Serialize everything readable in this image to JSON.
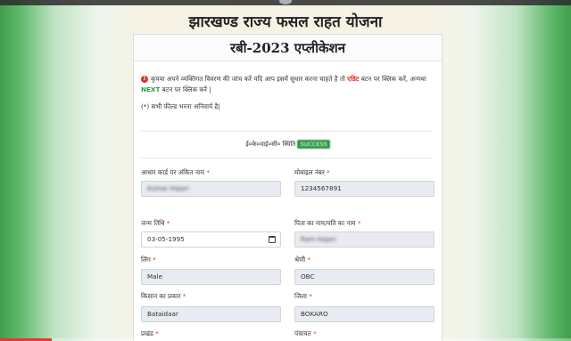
{
  "page": {
    "title": "झारखण्ड राज्य फसल राहत योजना"
  },
  "card": {
    "header": "रबी-2023 एप्लीकेशन",
    "notice_before": "कृपया अपने व्यक्तिगत विवरण की जांच करें यदि आप इसमें सुधार करना चाहते है तो ",
    "notice_edit": "एडिट",
    "notice_middle": " बटन पर क्लिक करें, अन्यथा ",
    "notice_next": "NEXT",
    "notice_after": " बटन पर क्लिक करें |",
    "mandatory_note": "(*) सभी फ़ील्ड भरना अनिवार्य है|",
    "status_label": "ई०के०वाई०सी० स्थिति",
    "status_value": "SUCCESS"
  },
  "form": {
    "aadhaar_name_label": "आधार कार्ड पर अंकित नाम",
    "aadhaar_name_value": "Kumar Hajari",
    "mobile_label": "मोबाइल नंबर",
    "mobile_value": "1234567891",
    "dob_label": "जन्म तिथि",
    "dob_value": "03-05-1995",
    "father_label": "पिता का नाम/पति का नाम",
    "father_value": "Ram Hajari",
    "gender_label": "लिंग",
    "gender_value": "Male",
    "category_label": "श्रेणी",
    "category_value": "OBC",
    "farmer_type_label": "किसान का प्रकार",
    "farmer_type_value": "Bataidaar",
    "district_label": "जिला",
    "district_value": "BOKARO",
    "block_label": "प्रखंड",
    "panchayat_label": "पंचायत",
    "required_mark": "*"
  },
  "video": {
    "progress": 0.09
  },
  "colors": {
    "accent_red": "#d9362f",
    "accent_green": "#2e9c46",
    "input_filled_bg": "#e8ebf1"
  }
}
